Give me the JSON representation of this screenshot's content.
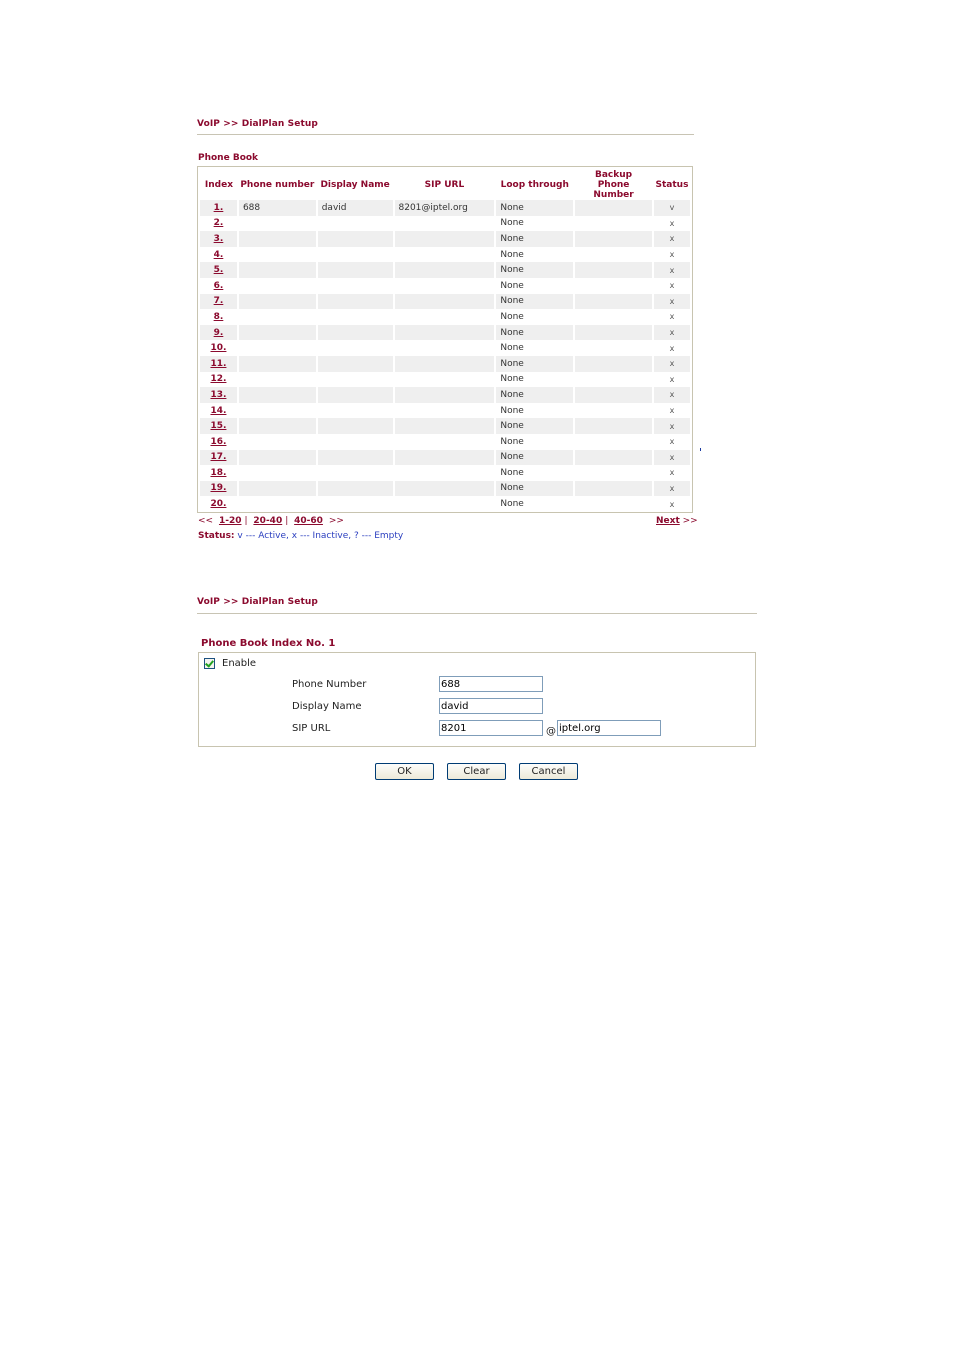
{
  "list_page": {
    "breadcrumb": "VoIP >> DialPlan Setup",
    "section_title": "Phone Book",
    "columns": [
      "Index",
      "Phone number",
      "Display Name",
      "SIP URL",
      "Loop through",
      "Backup Phone Number",
      "Status"
    ],
    "rows": [
      {
        "index": "1.",
        "phone": "688",
        "display": "david",
        "sip": "8201@iptel.org",
        "loop": "None",
        "backup": "",
        "status": "v"
      },
      {
        "index": "2.",
        "phone": "",
        "display": "",
        "sip": "",
        "loop": "None",
        "backup": "",
        "status": "x"
      },
      {
        "index": "3.",
        "phone": "",
        "display": "",
        "sip": "",
        "loop": "None",
        "backup": "",
        "status": "x"
      },
      {
        "index": "4.",
        "phone": "",
        "display": "",
        "sip": "",
        "loop": "None",
        "backup": "",
        "status": "x"
      },
      {
        "index": "5.",
        "phone": "",
        "display": "",
        "sip": "",
        "loop": "None",
        "backup": "",
        "status": "x"
      },
      {
        "index": "6.",
        "phone": "",
        "display": "",
        "sip": "",
        "loop": "None",
        "backup": "",
        "status": "x"
      },
      {
        "index": "7.",
        "phone": "",
        "display": "",
        "sip": "",
        "loop": "None",
        "backup": "",
        "status": "x"
      },
      {
        "index": "8.",
        "phone": "",
        "display": "",
        "sip": "",
        "loop": "None",
        "backup": "",
        "status": "x"
      },
      {
        "index": "9.",
        "phone": "",
        "display": "",
        "sip": "",
        "loop": "None",
        "backup": "",
        "status": "x"
      },
      {
        "index": "10.",
        "phone": "",
        "display": "",
        "sip": "",
        "loop": "None",
        "backup": "",
        "status": "x"
      },
      {
        "index": "11.",
        "phone": "",
        "display": "",
        "sip": "",
        "loop": "None",
        "backup": "",
        "status": "x"
      },
      {
        "index": "12.",
        "phone": "",
        "display": "",
        "sip": "",
        "loop": "None",
        "backup": "",
        "status": "x"
      },
      {
        "index": "13.",
        "phone": "",
        "display": "",
        "sip": "",
        "loop": "None",
        "backup": "",
        "status": "x"
      },
      {
        "index": "14.",
        "phone": "",
        "display": "",
        "sip": "",
        "loop": "None",
        "backup": "",
        "status": "x"
      },
      {
        "index": "15.",
        "phone": "",
        "display": "",
        "sip": "",
        "loop": "None",
        "backup": "",
        "status": "x"
      },
      {
        "index": "16.",
        "phone": "",
        "display": "",
        "sip": "",
        "loop": "None",
        "backup": "",
        "status": "x"
      },
      {
        "index": "17.",
        "phone": "",
        "display": "",
        "sip": "",
        "loop": "None",
        "backup": "",
        "status": "x"
      },
      {
        "index": "18.",
        "phone": "",
        "display": "",
        "sip": "",
        "loop": "None",
        "backup": "",
        "status": "x"
      },
      {
        "index": "19.",
        "phone": "",
        "display": "",
        "sip": "",
        "loop": "None",
        "backup": "",
        "status": "x"
      },
      {
        "index": "20.",
        "phone": "",
        "display": "",
        "sip": "",
        "loop": "None",
        "backup": "",
        "status": "x"
      }
    ],
    "pager": {
      "prev": "<<",
      "pages": [
        "1-20",
        "20-40",
        "40-60"
      ],
      "separator": "|",
      "more": ">>",
      "next_label": "Next",
      "next_arrow": ">>"
    },
    "legend": {
      "label": "Status:",
      "text": "v --- Active, x --- Inactive, ? --- Empty"
    }
  },
  "edit_page": {
    "breadcrumb": "VoIP >> DialPlan Setup",
    "section_title": "Phone Book Index No. 1",
    "enable_label": "Enable",
    "enable_checked": true,
    "fields": {
      "phone_number": {
        "label": "Phone Number",
        "value": "688"
      },
      "display_name": {
        "label": "Display Name",
        "value": "david"
      },
      "sip_url": {
        "label": "SIP URL",
        "user": "8201",
        "at": "@",
        "domain": "iptel.org"
      }
    },
    "buttons": {
      "ok": "OK",
      "clear": "Clear",
      "cancel": "Cancel"
    }
  }
}
